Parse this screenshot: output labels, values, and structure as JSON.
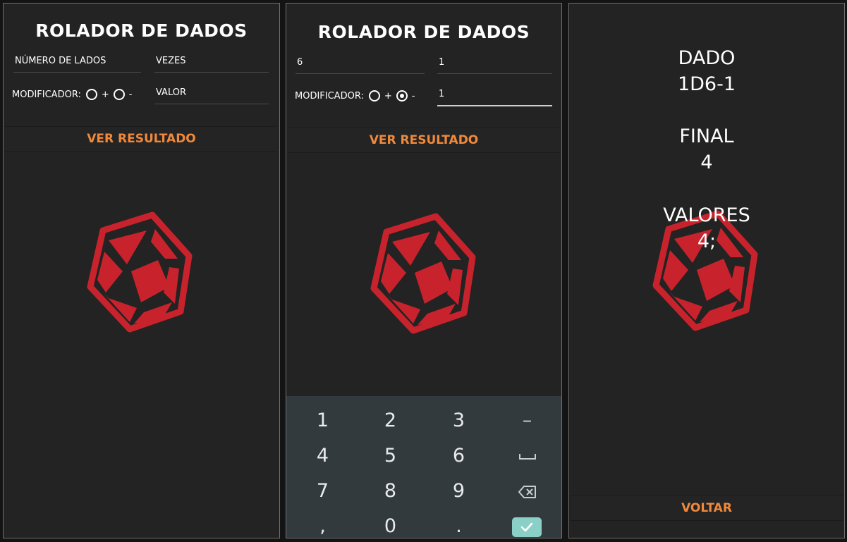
{
  "app": {
    "title": "ROLADOR DE DADOS",
    "accent_color": "#f0893b",
    "dice_color": "#c8232c",
    "dice_icon": "d20-dice-icon"
  },
  "screen1": {
    "sides_placeholder": "NÚMERO DE LADOS",
    "times_placeholder": "VEZES",
    "modifier_label": "MODIFICADOR:",
    "plus": "+",
    "minus": "-",
    "value_placeholder": "VALOR",
    "submit_label": "VER RESULTADO"
  },
  "screen2": {
    "sides_value": "6",
    "times_value": "1",
    "modifier_label": "MODIFICADOR:",
    "plus": "+",
    "minus": "-",
    "selected_modifier": "-",
    "value_value": "1",
    "submit_label": "VER RESULTADO",
    "keypad": {
      "keys": [
        "1",
        "2",
        "3",
        "–",
        "4",
        "5",
        "6",
        "␣",
        "7",
        "8",
        "9",
        "⌫",
        ",",
        "0",
        ".",
        "✓"
      ]
    }
  },
  "screen3": {
    "dice_label": "DADO",
    "dice_value": "1D6-1",
    "final_label": "FINAL",
    "final_value": "4",
    "values_label": "VALORES",
    "values_value": "4;",
    "back_label": "VOLTAR"
  }
}
